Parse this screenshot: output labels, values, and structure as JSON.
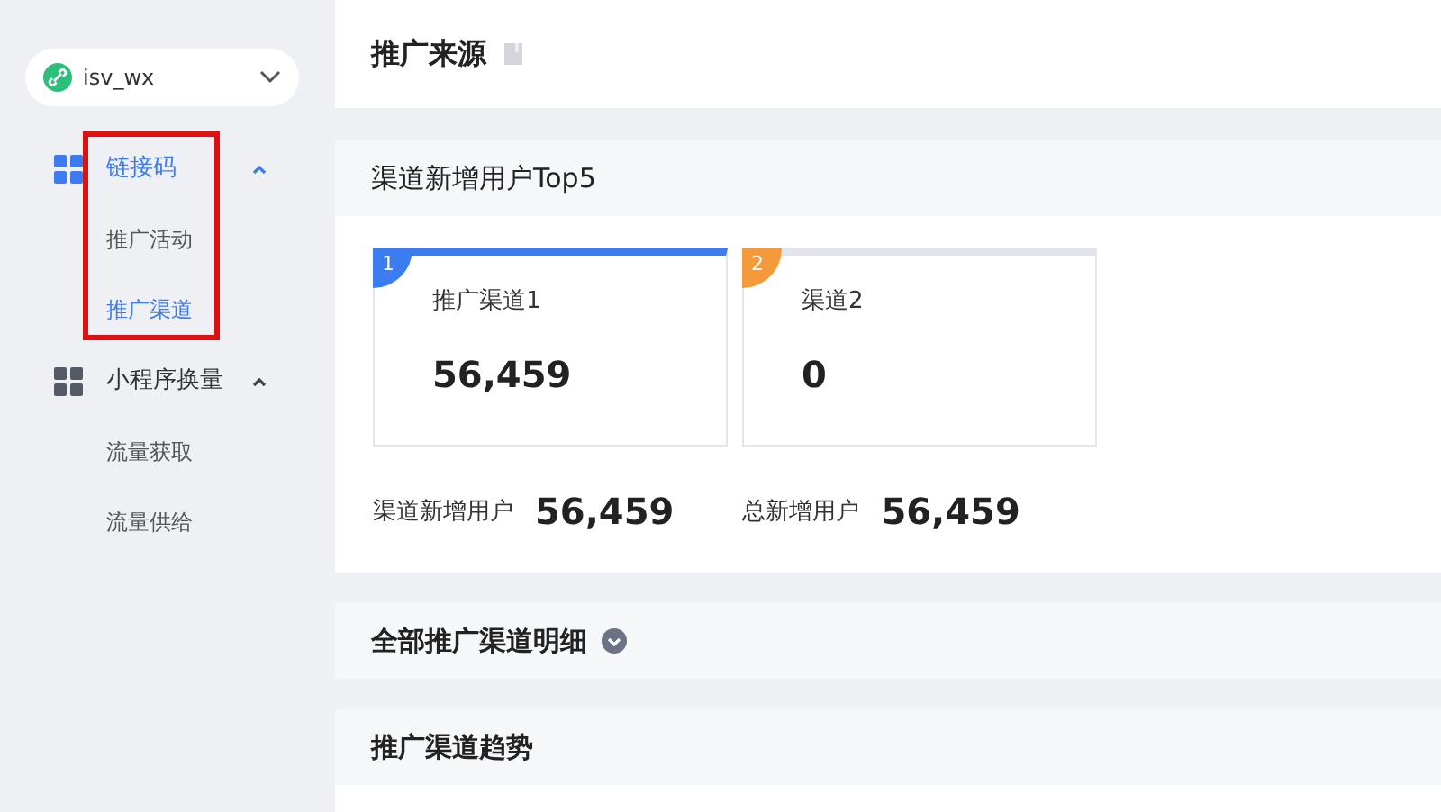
{
  "account_select": {
    "value": "isv_wx"
  },
  "menu": [
    {
      "label": "链接码",
      "active": true,
      "expanded": true,
      "highlighted": true,
      "children": [
        {
          "label": "推广活动",
          "selected": false
        },
        {
          "label": "推广渠道",
          "selected": true
        }
      ]
    },
    {
      "label": "小程序换量",
      "active": false,
      "expanded": true,
      "highlighted": false,
      "children": [
        {
          "label": "流量获取",
          "selected": false
        },
        {
          "label": "流量供给",
          "selected": false
        }
      ]
    }
  ],
  "page_title": "推广来源",
  "top_section": {
    "title": "渠道新增用户Top5",
    "cards": [
      {
        "rank": "1",
        "color": "#3b7cf0",
        "name": "推广渠道1",
        "value": "56,459",
        "selected": true
      },
      {
        "rank": "2",
        "color": "#f49a3b",
        "name": "渠道2",
        "value": "0",
        "selected": false
      }
    ],
    "stats": [
      {
        "label": "渠道新增用户",
        "value": "56,459"
      },
      {
        "label": "总新增用户",
        "value": "56,459"
      }
    ]
  },
  "sections": [
    {
      "title": "全部推广渠道明细",
      "expandable": true
    },
    {
      "title": "推广渠道趋势",
      "expandable": false
    }
  ]
}
